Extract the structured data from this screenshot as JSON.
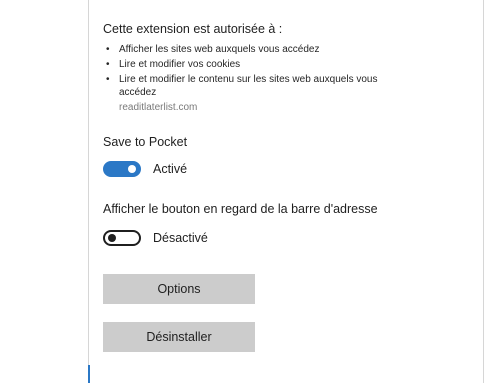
{
  "permissions": {
    "heading": "Cette extension est autorisée à :",
    "items": [
      "Afficher les sites web auxquels vous accédez",
      "Lire et modifier vos cookies",
      "Lire et modifier le contenu sur les sites web auxquels vous accédez"
    ],
    "domain": "readitlaterlist.com"
  },
  "settings": {
    "save_to_pocket": {
      "label": "Save to Pocket",
      "state": "Activé",
      "on": true
    },
    "address_bar_button": {
      "label": "Afficher le bouton en regard de la barre d'adresse",
      "state": "Désactivé",
      "on": false
    }
  },
  "buttons": {
    "options": "Options",
    "uninstall": "Désinstaller"
  },
  "colors": {
    "accent": "#2b78c6",
    "button_bg": "#cccccc"
  }
}
